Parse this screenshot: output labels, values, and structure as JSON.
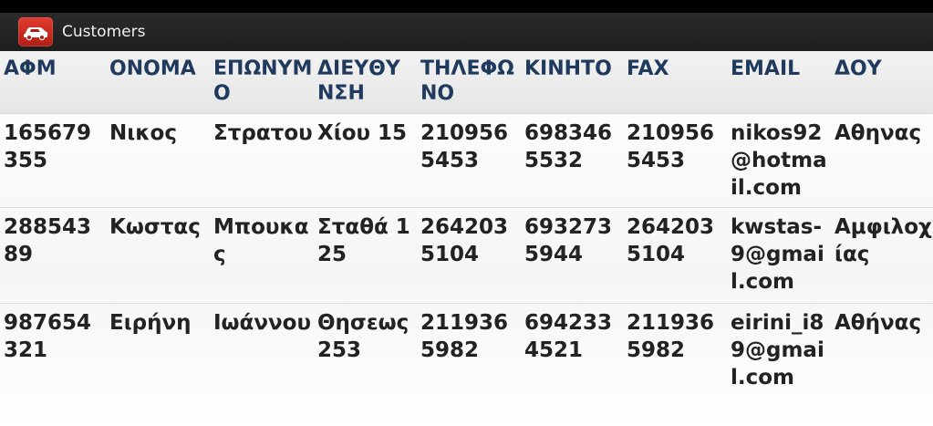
{
  "app": {
    "title": "Customers",
    "icon": "car-icon",
    "accent": "#c8281f"
  },
  "table": {
    "columns": [
      "ΑΦΜ",
      "ΟΝΟΜΑ",
      "ΕΠΩΝΥΜΟ",
      "ΔΙΕΥΘΥΝΣΗ",
      "ΤΗΛΕΦΩΝΟ",
      "ΚΙΝΗΤΟ",
      "FAX",
      "EMAIL",
      "ΔΟΥ"
    ],
    "rows": [
      [
        "165679355",
        "Νικος",
        "Στρατου",
        "Χίου 15",
        "2109565453",
        "6983465532",
        "2109565453",
        "nikos92@hotmail.com",
        "Αθηνας"
      ],
      [
        "28854389",
        "Κωστας",
        "Μπουκας",
        "Σταθά 125",
        "2642035104",
        "6932735944",
        "2642035104",
        "kwstas-9@gmail.com",
        "Αμφιλοχίας"
      ],
      [
        "987654321",
        "Ειρήνη",
        "Ιωάννου",
        "Θησεως 253",
        "2119365982",
        "6942334521",
        "2119365982",
        "eirini_i89@gmail.com",
        "Αθήνας"
      ]
    ]
  }
}
